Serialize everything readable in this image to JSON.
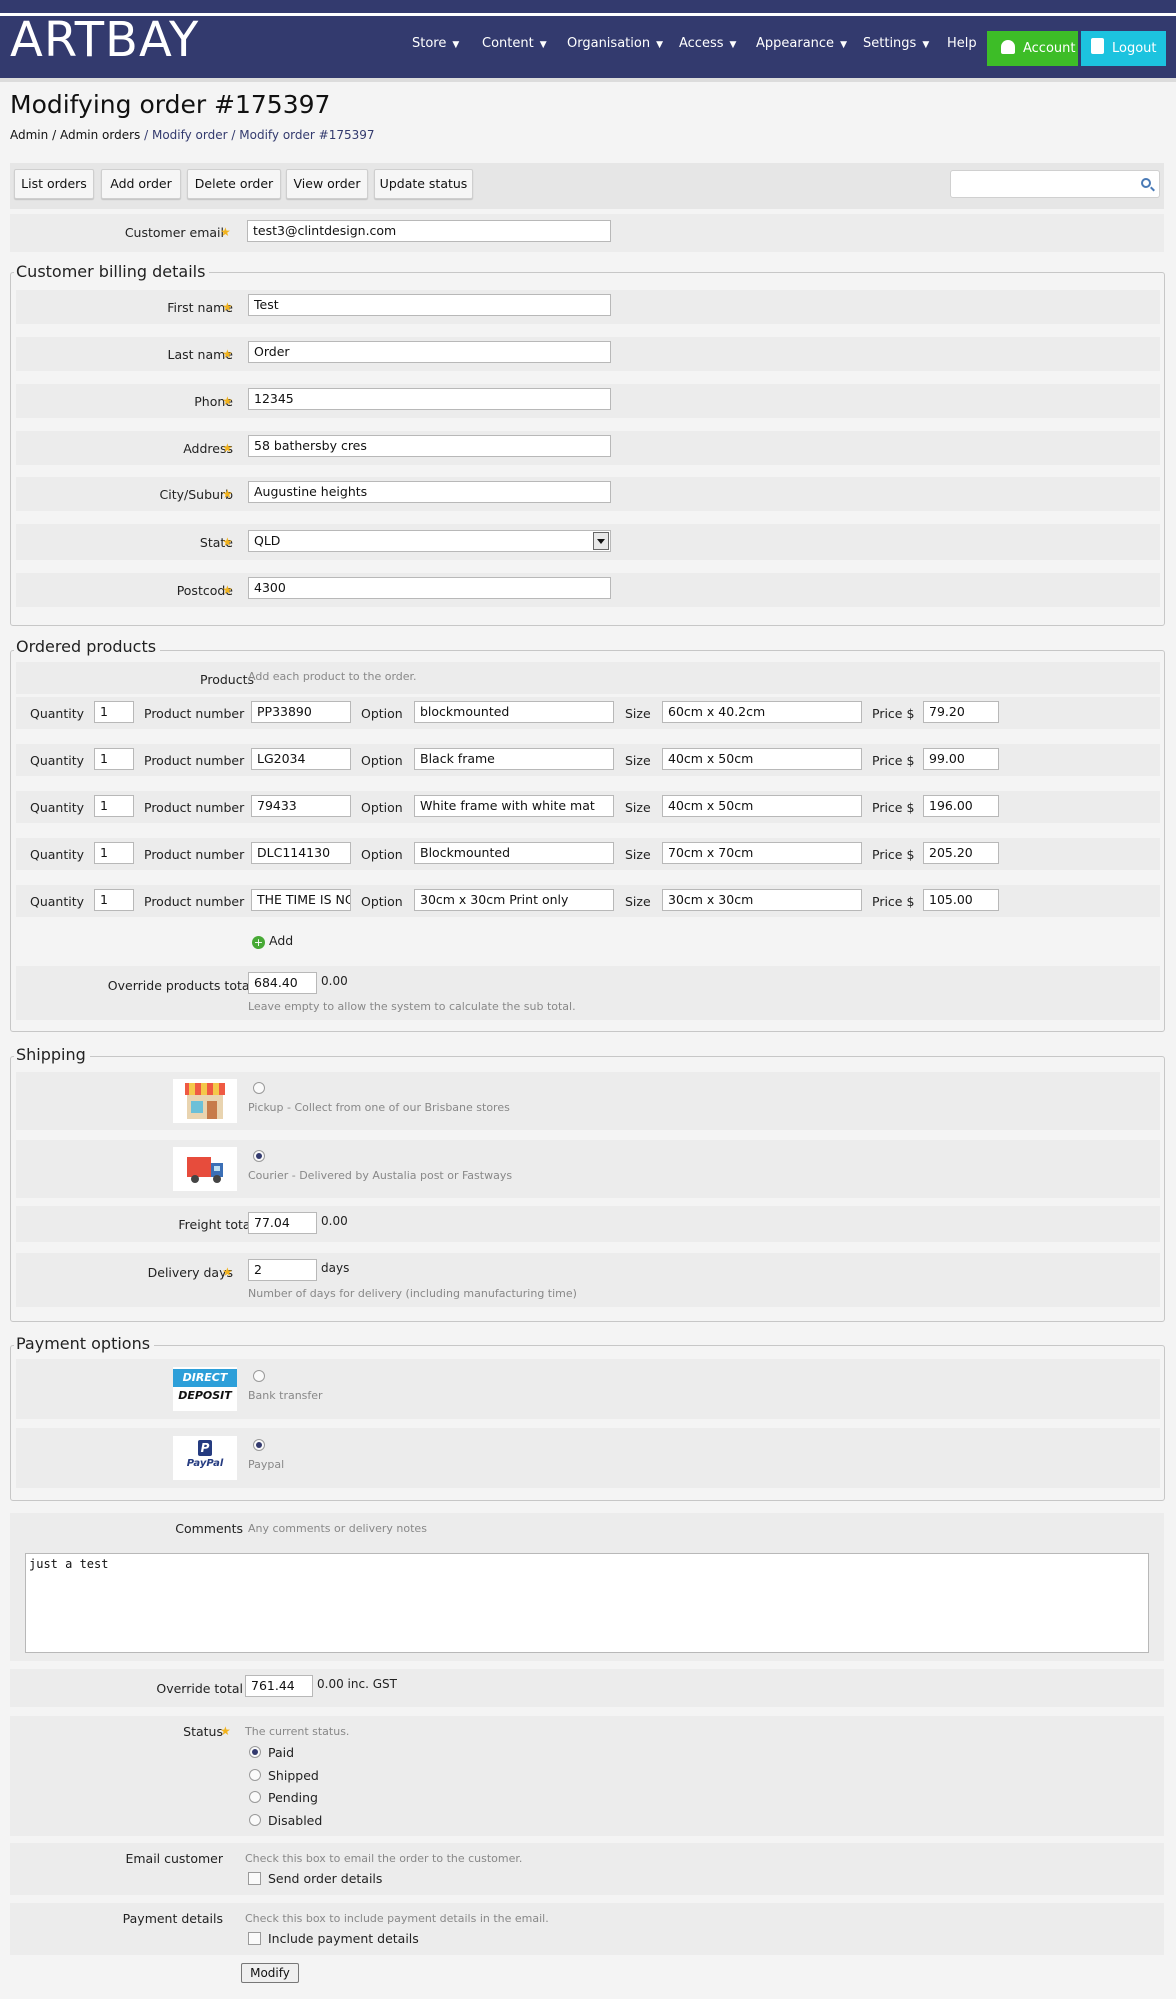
{
  "brand": {
    "logo_text": "ARTBAY"
  },
  "nav": {
    "items": [
      {
        "label": "Store",
        "caret": "▼"
      },
      {
        "label": "Content",
        "caret": "▼"
      },
      {
        "label": "Organisation",
        "caret": "▼"
      },
      {
        "label": "Access",
        "caret": "▼"
      },
      {
        "label": "Appearance",
        "caret": "▼"
      },
      {
        "label": "Settings",
        "caret": "▼"
      },
      {
        "label": "Help",
        "caret": ""
      }
    ],
    "account_label": "Account",
    "logout_label": "Logout",
    "colors": {
      "header_bg": "#333a6e",
      "account_bg": "#3dbd27",
      "logout_bg": "#1cc3df"
    }
  },
  "page": {
    "title": "Modifying order #175397",
    "breadcrumb": [
      "Admin",
      "/",
      "Admin orders",
      "/",
      "Modify order",
      "/",
      "Modify order #175397"
    ]
  },
  "toolbar": {
    "buttons": [
      "List orders",
      "Add order",
      "Delete order",
      "View order",
      "Update status"
    ],
    "search_value": ""
  },
  "customer": {
    "email_label": "Customer email",
    "email": "test3@clintdesign.com"
  },
  "billing": {
    "legend": "Customer billing details",
    "fields": [
      {
        "label": "First name",
        "value": "Test"
      },
      {
        "label": "Last name",
        "value": "Order"
      },
      {
        "label": "Phone",
        "value": "12345"
      },
      {
        "label": "Address",
        "value": "58 bathersby cres"
      },
      {
        "label": "City/Suburb",
        "value": "Augustine heights"
      },
      {
        "label": "State",
        "value": "QLD"
      },
      {
        "label": "Postcode",
        "value": "4300"
      }
    ]
  },
  "products": {
    "legend": "Ordered products",
    "label": "Products",
    "hint": "Add each product to the order.",
    "col_labels": {
      "quantity": "Quantity",
      "product_number": "Product number",
      "option": "Option",
      "size": "Size",
      "price": "Price $"
    },
    "rows": [
      {
        "quantity": "1",
        "product_number": "PP33890",
        "option": "blockmounted",
        "size": "60cm x 40.2cm",
        "price": "79.20"
      },
      {
        "quantity": "1",
        "product_number": "LG2034",
        "option": "Black frame",
        "size": "40cm x 50cm",
        "price": "99.00"
      },
      {
        "quantity": "1",
        "product_number": "79433",
        "option": "White frame with white mat",
        "size": "40cm x 50cm",
        "price": "196.00"
      },
      {
        "quantity": "1",
        "product_number": "DLC114130",
        "option": "Blockmounted",
        "size": "70cm x 70cm",
        "price": "205.20"
      },
      {
        "quantity": "1",
        "product_number": "THE TIME IS NO",
        "option": "30cm x 30cm Print only",
        "size": "30cm x 30cm",
        "price": "105.00"
      }
    ],
    "add_label": "Add",
    "override_label": "Override products total",
    "override_value": "684.40",
    "override_calc": "0.00",
    "override_hint": "Leave empty to allow the system to calculate the sub total."
  },
  "shipping": {
    "legend": "Shipping",
    "options": [
      {
        "text": "Pickup - Collect from one of our Brisbane stores",
        "icon": "store-icon",
        "selected": false
      },
      {
        "text": "Courier - Delivered by Austalia post or Fastways",
        "icon": "delivery-truck-icon",
        "selected": true
      }
    ],
    "freight_label": "Freight total",
    "freight_value": "77.04",
    "freight_calc": "0.00",
    "delivery_label": "Delivery days",
    "delivery_value": "2",
    "delivery_unit": "days",
    "delivery_hint": "Number of days for delivery (including manufacturing time)"
  },
  "payment": {
    "legend": "Payment options",
    "options": [
      {
        "text": "Bank transfer",
        "logo_line1": "DIRECT",
        "logo_line2": "DEPOSIT",
        "selected": false
      },
      {
        "text": "Paypal",
        "logo_line1": "PayPal",
        "selected": true
      }
    ]
  },
  "comments": {
    "label": "Comments",
    "hint": "Any comments or delivery notes",
    "value": "just a test"
  },
  "total": {
    "label": "Override total",
    "value": "761.44",
    "calc": "0.00 inc. GST"
  },
  "status": {
    "label": "Status",
    "hint": "The current status.",
    "options": [
      {
        "label": "Paid",
        "selected": true
      },
      {
        "label": "Shipped",
        "selected": false
      },
      {
        "label": "Pending",
        "selected": false
      },
      {
        "label": "Disabled",
        "selected": false
      }
    ]
  },
  "email_customer": {
    "label": "Email customer",
    "hint": "Check this box to email the order to the customer.",
    "checkbox": "Send order details"
  },
  "payment_details": {
    "label": "Payment details",
    "hint": "Check this box to include payment details in the email.",
    "checkbox": "Include payment details"
  },
  "submit_label": "Modify"
}
